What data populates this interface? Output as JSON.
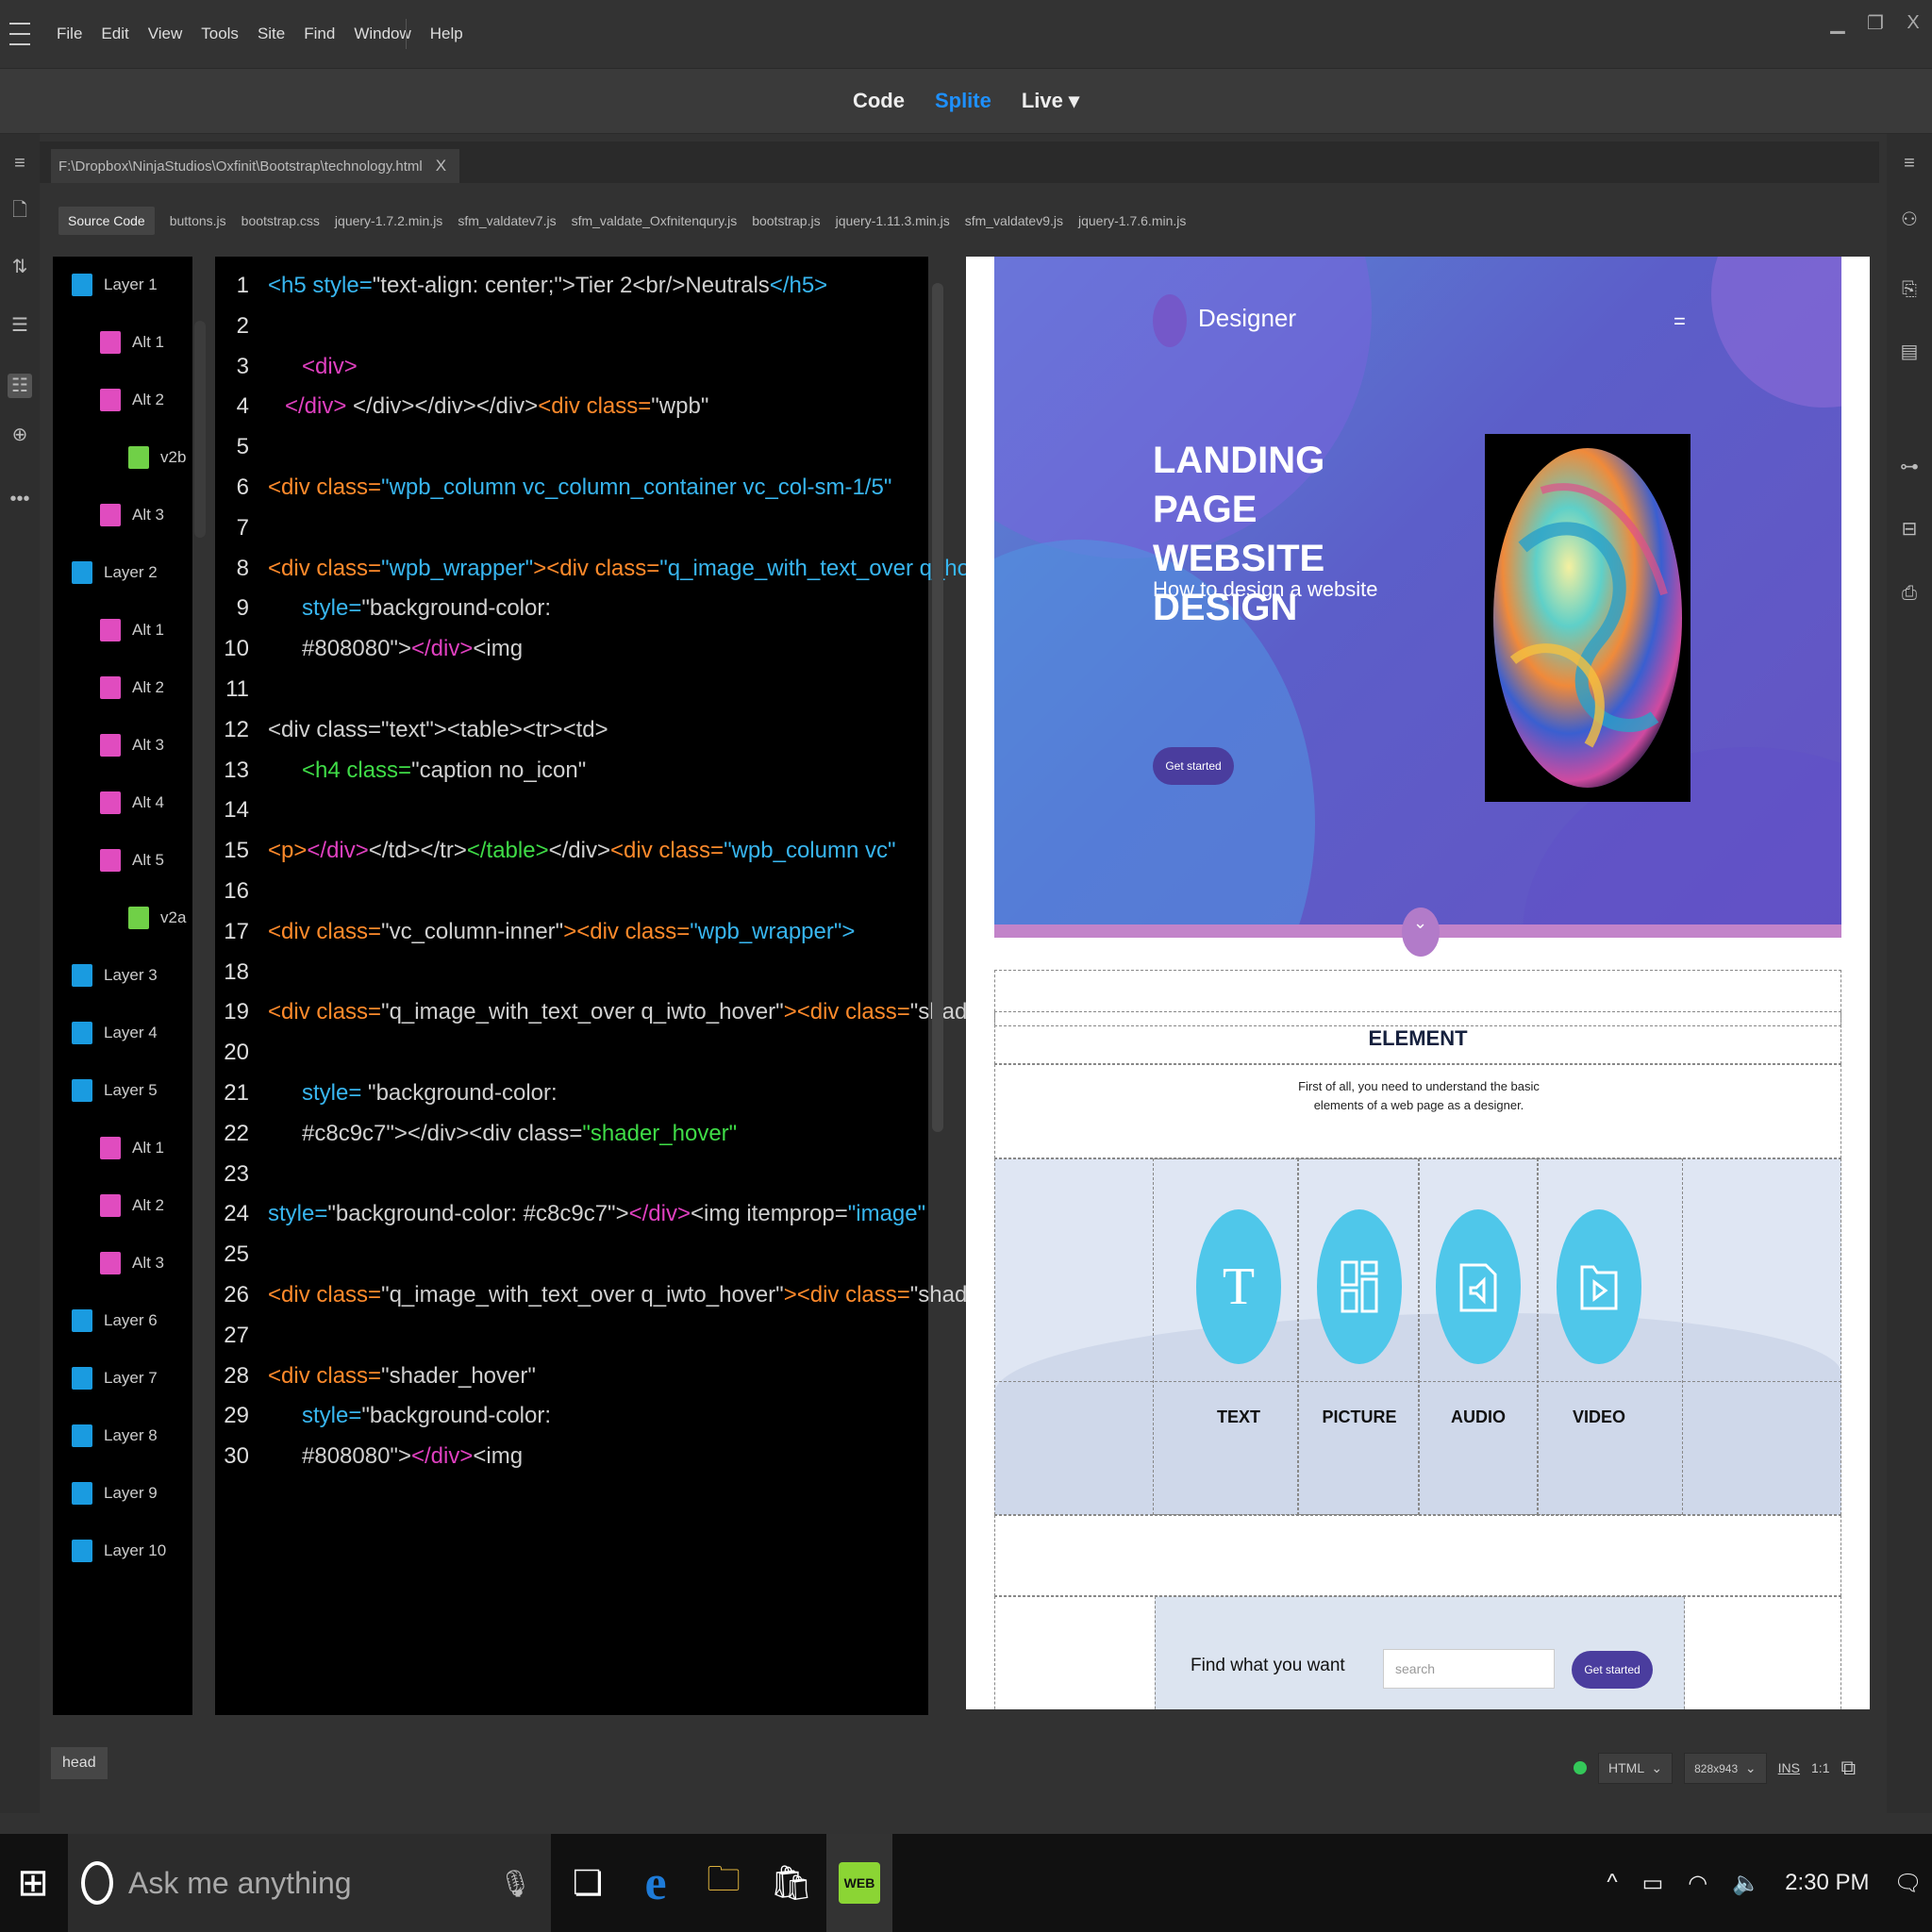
{
  "menubar": {
    "items": [
      "File",
      "Edit",
      "View",
      "Tools",
      "Site",
      "Find",
      "Window",
      "Help"
    ],
    "window_controls": [
      "minimize",
      "restore",
      "X"
    ]
  },
  "viewmodes": {
    "code": "Code",
    "split": "Splite",
    "live": "Live ▾",
    "active": "Splite",
    "active_color": "#1e90ff"
  },
  "doc_tab": {
    "path": "F:\\Dropbox\\NinjaStudios\\Oxfinit\\Bootstrap\\technology.html",
    "close": "X"
  },
  "files": [
    "Source Code",
    "buttons.js",
    "bootstrap.css",
    "jquery-1.7.2.min.js",
    "sfm_valdatev7.js",
    "sfm_valdate_Oxfnitenqury.js",
    "bootstrap.js",
    "jquery-1.11.3.min.js",
    "sfm_valdatev9.js",
    "jquery-1.7.6.min.js"
  ],
  "layers": [
    {
      "label": "Layer 1",
      "kind": "blue",
      "indent": 0
    },
    {
      "label": "Alt 1",
      "kind": "pink",
      "indent": 1
    },
    {
      "label": "Alt 2",
      "kind": "pink",
      "indent": 1
    },
    {
      "label": "v2b",
      "kind": "green",
      "indent": 2
    },
    {
      "label": "Alt 3",
      "kind": "pink",
      "indent": 1
    },
    {
      "label": "Layer 2",
      "kind": "blue",
      "indent": 0
    },
    {
      "label": "Alt 1",
      "kind": "pink",
      "indent": 1
    },
    {
      "label": "Alt 2",
      "kind": "pink",
      "indent": 1
    },
    {
      "label": "Alt 3",
      "kind": "pink",
      "indent": 1
    },
    {
      "label": "Alt 4",
      "kind": "pink",
      "indent": 1
    },
    {
      "label": "Alt 5",
      "kind": "pink",
      "indent": 1
    },
    {
      "label": "v2a",
      "kind": "green",
      "indent": 2
    },
    {
      "label": "Layer 3",
      "kind": "blue",
      "indent": 0
    },
    {
      "label": "Layer 4",
      "kind": "blue",
      "indent": 0
    },
    {
      "label": "Layer 5",
      "kind": "blue",
      "indent": 0
    },
    {
      "label": "Alt 1",
      "kind": "pink",
      "indent": 1
    },
    {
      "label": "Alt 2",
      "kind": "pink",
      "indent": 1
    },
    {
      "label": "Alt 3",
      "kind": "pink",
      "indent": 1
    },
    {
      "label": "Layer 6",
      "kind": "blue",
      "indent": 0
    },
    {
      "label": "Layer 7",
      "kind": "blue",
      "indent": 0
    },
    {
      "label": "Layer 8",
      "kind": "blue",
      "indent": 0
    },
    {
      "label": "Layer 9",
      "kind": "blue",
      "indent": 0
    },
    {
      "label": "Layer 10",
      "kind": "blue",
      "indent": 0
    }
  ],
  "code_lines": [
    {
      "n": "1",
      "indent": 0,
      "parts": [
        [
          "<h5 ",
          "bl"
        ],
        [
          "style=",
          "bl"
        ],
        [
          "\"text-align: center;\">",
          "wh"
        ],
        [
          "Tier 2<br/>Neutrals",
          "wh"
        ],
        [
          "</h5>",
          "bl"
        ]
      ]
    },
    {
      "n": "2",
      "indent": 0,
      "parts": []
    },
    {
      "n": "3",
      "indent": 2,
      "parts": [
        [
          "<div>",
          "pk"
        ]
      ]
    },
    {
      "n": "4",
      "indent": 1,
      "parts": [
        [
          "</div>",
          "pk"
        ],
        [
          " </div></div></div>",
          "wh"
        ],
        [
          "<div class=",
          "or"
        ],
        [
          "\"wpb\"",
          "wh"
        ]
      ]
    },
    {
      "n": "5",
      "indent": 0,
      "parts": []
    },
    {
      "n": "6",
      "indent": 0,
      "parts": [
        [
          "<div class=",
          "or"
        ],
        [
          "\"wpb_column vc_column_container vc_col-sm-1/5\"",
          "bl"
        ]
      ]
    },
    {
      "n": "7",
      "indent": 0,
      "parts": []
    },
    {
      "n": "8",
      "indent": 0,
      "parts": [
        [
          "<div class=",
          "or"
        ],
        [
          "\"wpb_wrapper\"",
          "bl"
        ],
        [
          "><div class=",
          "or"
        ],
        [
          "\"q_image_with_text_over q_hover\"",
          "bl"
        ]
      ]
    },
    {
      "n": "9",
      "indent": 2,
      "parts": [
        [
          "style=",
          "bl"
        ],
        [
          "\"background-color:",
          "wh"
        ]
      ]
    },
    {
      "n": "10",
      "indent": 2,
      "parts": [
        [
          "#808080\">",
          "wh"
        ],
        [
          "</div>",
          "pk"
        ],
        [
          "<img",
          "wh"
        ]
      ]
    },
    {
      "n": "11",
      "indent": 0,
      "parts": []
    },
    {
      "n": "12",
      "indent": 0,
      "parts": [
        [
          "<div class=\"text\"><table><tr><td>",
          "wh"
        ]
      ]
    },
    {
      "n": "13",
      "indent": 2,
      "parts": [
        [
          "<h4 class=",
          "gr"
        ],
        [
          "\"caption no_icon\"",
          "wh"
        ]
      ]
    },
    {
      "n": "14",
      "indent": 0,
      "parts": []
    },
    {
      "n": "15",
      "indent": 0,
      "parts": [
        [
          "<p>",
          "or"
        ],
        [
          "</div>",
          "pk"
        ],
        [
          "</td></tr>",
          "wh"
        ],
        [
          "</table>",
          "gr"
        ],
        [
          "</div>",
          "wh"
        ],
        [
          "<div class=",
          "or"
        ],
        [
          "\"wpb_column vc\"",
          "bl"
        ]
      ]
    },
    {
      "n": "16",
      "indent": 0,
      "parts": []
    },
    {
      "n": "17",
      "indent": 0,
      "parts": [
        [
          "<div  class=",
          "or"
        ],
        [
          "\"vc_column-inner\"",
          "wh"
        ],
        [
          "><div class=",
          "or"
        ],
        [
          "\"wpb_wrapper\">",
          "bl"
        ]
      ]
    },
    {
      "n": "18",
      "indent": 0,
      "parts": []
    },
    {
      "n": "19",
      "indent": 0,
      "parts": [
        [
          "<div class=",
          "or"
        ],
        [
          "\"q_image_with_text_over q_iwto_hover\"",
          "wh"
        ],
        [
          "><div class=",
          "or"
        ],
        [
          "\"shader\"",
          "wh"
        ]
      ]
    },
    {
      "n": "20",
      "indent": 0,
      "parts": []
    },
    {
      "n": "21",
      "indent": 2,
      "parts": [
        [
          "style=",
          "bl"
        ],
        [
          " \"background-color:",
          "wh"
        ]
      ]
    },
    {
      "n": "22",
      "indent": 2,
      "parts": [
        [
          "#c8c9c7\"></div><div class=",
          "wh"
        ],
        [
          "\"shader_hover\"",
          "gr"
        ]
      ]
    },
    {
      "n": "23",
      "indent": 0,
      "parts": []
    },
    {
      "n": "24",
      "indent": 0,
      "parts": [
        [
          "style=",
          "bl"
        ],
        [
          "\"background-color: #c8c9c7\">",
          "wh"
        ],
        [
          "</div>",
          "pk"
        ],
        [
          "<img itemprop=",
          "wh"
        ],
        [
          "\"image\"",
          "bl"
        ]
      ]
    },
    {
      "n": "25",
      "indent": 0,
      "parts": []
    },
    {
      "n": "26",
      "indent": 0,
      "parts": [
        [
          "<div class=",
          "or"
        ],
        [
          "\"q_image_with_text_over q_iwto_hover\"",
          "wh"
        ],
        [
          "><div class=",
          "or"
        ],
        [
          "\"shader\"",
          "wh"
        ]
      ]
    },
    {
      "n": "27",
      "indent": 0,
      "parts": []
    },
    {
      "n": "28",
      "indent": 0,
      "parts": [
        [
          "<div class=",
          "or"
        ],
        [
          "\"shader_hover\"",
          "wh"
        ]
      ]
    },
    {
      "n": "29",
      "indent": 2,
      "parts": [
        [
          "style=",
          "bl"
        ],
        [
          "\"background-color:",
          "wh"
        ]
      ]
    },
    {
      "n": "30",
      "indent": 2,
      "parts": [
        [
          "#808080\">",
          "wh"
        ],
        [
          "</div>",
          "pk"
        ],
        [
          "<img",
          "wh"
        ]
      ]
    }
  ],
  "preview": {
    "brand": "Designer",
    "menu_icon": "=",
    "hero_title": "LANDING PAGE WEBSITE DESIGN",
    "hero_sub": "How to design a website",
    "hero_btn": "Get started",
    "element_title": "ELEMENT",
    "element_desc": "First of all, you need to understand the basic elements of a web page as a designer.",
    "elements": [
      {
        "label": "TEXT",
        "icon": "T"
      },
      {
        "label": "PICTURE",
        "icon": "picture-icon"
      },
      {
        "label": "AUDIO",
        "icon": "audio-icon"
      },
      {
        "label": "VIDEO",
        "icon": "video-icon"
      }
    ],
    "find_label": "Find what you want",
    "search_placeholder": "search",
    "find_btn": "Get started"
  },
  "status": {
    "tag": "head",
    "language": "HTML",
    "size": "828x943",
    "mode": "INS",
    "ratio": "1:1"
  },
  "taskbar": {
    "search_placeholder": "Ask me anything",
    "clock": "2:30 PM"
  }
}
